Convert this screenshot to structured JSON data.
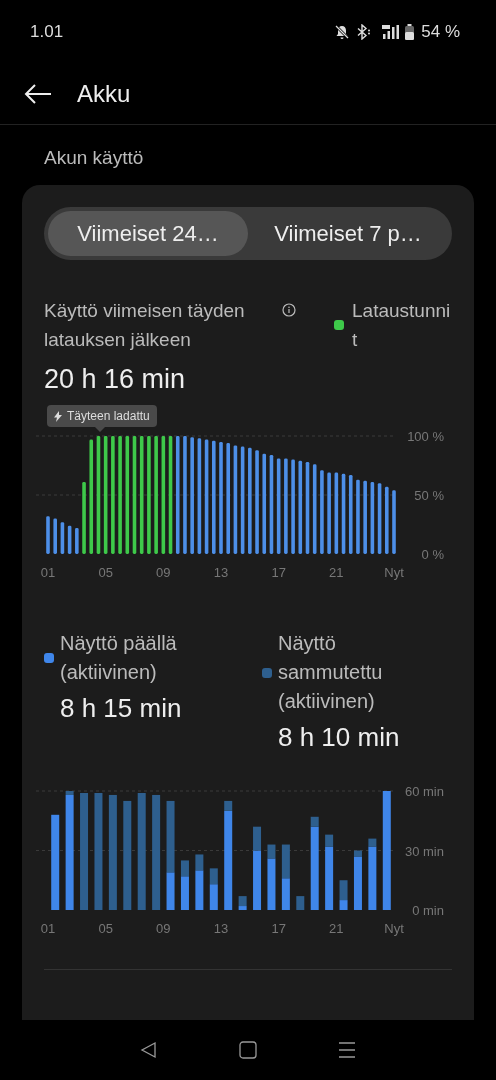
{
  "status_bar": {
    "time": "1.01",
    "battery": "54 %"
  },
  "header": {
    "title": "Akku"
  },
  "section_title": "Akun käyttö",
  "tabs": [
    {
      "label": "Viimeiset 24…",
      "selected": true
    },
    {
      "label": "Viimeiset 7 p…",
      "selected": false
    }
  ],
  "usage": {
    "label": "Käyttö viimeisen täyden latauksen jälkeen",
    "value": "20 h 16 min",
    "legend": {
      "label": "Lataustunnit",
      "color": "#3ec94a"
    }
  },
  "battery_chart": {
    "tooltip": "Täyteen ladattu",
    "chart_data": {
      "type": "bar",
      "stacked": true,
      "x": [
        1,
        1.5,
        2,
        2.5,
        3,
        3.5,
        4,
        4.5,
        5,
        5.5,
        6,
        6.5,
        7,
        7.5,
        8,
        8.5,
        9,
        9.5,
        10,
        10.5,
        11,
        11.5,
        12,
        12.5,
        13,
        13.5,
        14,
        14.5,
        15,
        15.5,
        16,
        16.5,
        17,
        17.5,
        18,
        18.5,
        19,
        19.5,
        20,
        20.5,
        21,
        21.5,
        22,
        22.5,
        23,
        23.5,
        24,
        24.5,
        25
      ],
      "series": [
        {
          "color": "#3ec94a",
          "values": [
            null,
            null,
            null,
            null,
            null,
            61,
            97,
            100,
            100,
            100,
            100,
            100,
            100,
            100,
            100,
            100,
            100,
            100,
            null,
            null,
            null,
            null,
            null,
            null,
            null,
            null,
            null,
            null,
            null,
            null,
            null,
            null,
            null,
            null,
            null,
            null,
            null,
            null,
            null,
            null,
            null,
            null,
            null,
            null,
            null,
            null,
            null,
            null,
            null
          ]
        },
        {
          "color": "#4d8fe8",
          "values": [
            32,
            30,
            27,
            24,
            22,
            null,
            null,
            null,
            null,
            null,
            null,
            null,
            null,
            null,
            null,
            null,
            null,
            null,
            100,
            100,
            99,
            98,
            97,
            96,
            95,
            94,
            92,
            91,
            90,
            88,
            85,
            84,
            81,
            81,
            80,
            79,
            78,
            76,
            71,
            69,
            69,
            68,
            67,
            63,
            62,
            61,
            60,
            57,
            54
          ]
        }
      ],
      "xlim": [
        1,
        25
      ],
      "ylim": [
        0,
        100
      ],
      "yticks": [
        {
          "value": 0,
          "label": "0 %"
        },
        {
          "value": 50,
          "label": "50 %"
        },
        {
          "value": 100,
          "label": "100 %"
        }
      ],
      "xticks": [
        {
          "value": 1,
          "label": "01"
        },
        {
          "value": 5,
          "label": "05"
        },
        {
          "value": 9,
          "label": "09"
        },
        {
          "value": 13,
          "label": "13"
        },
        {
          "value": 17,
          "label": "17"
        },
        {
          "value": 21,
          "label": "21"
        },
        {
          "value": 25,
          "label": "Nyt"
        }
      ]
    }
  },
  "screen": {
    "items": [
      {
        "label": "Näyttö päällä (aktiivinen)",
        "value": "8 h 15 min",
        "color": "#3f86ea"
      },
      {
        "label": "Näyttö sammutettu (aktiivinen)",
        "value": "8 h 10 min",
        "color": "#2e5f8e"
      }
    ]
  },
  "screen_chart": {
    "chart_data": {
      "type": "bar",
      "stacked": true,
      "x": [
        1.5,
        2.5,
        3.5,
        4.5,
        5.5,
        6.5,
        7.5,
        8.5,
        9.5,
        10.5,
        11.5,
        12.5,
        13.5,
        14.5,
        15.5,
        16.5,
        17.5,
        18.5,
        19.5,
        20.5,
        21.5,
        22.5,
        23.5,
        24.5
      ],
      "series": [
        {
          "color": "#3f86ea",
          "values": [
            48,
            58,
            0,
            0,
            0,
            0,
            0,
            0,
            19,
            17,
            20,
            13,
            50,
            2,
            30,
            26,
            16,
            0,
            42,
            32,
            5,
            27,
            32,
            60
          ]
        },
        {
          "color": "#2e5f8e",
          "values": [
            0,
            2,
            59,
            59,
            58,
            55,
            59,
            58,
            36,
            8,
            8,
            8,
            5,
            5,
            12,
            7,
            17,
            7,
            5,
            6,
            10,
            3,
            4,
            0
          ]
        }
      ],
      "xlim": [
        1,
        25
      ],
      "ylim": [
        0,
        60
      ],
      "yticks": [
        {
          "value": 0,
          "label": "0 min"
        },
        {
          "value": 30,
          "label": "30 min"
        },
        {
          "value": 60,
          "label": "60 min"
        }
      ],
      "xticks": [
        {
          "value": 1,
          "label": "01"
        },
        {
          "value": 5,
          "label": "05"
        },
        {
          "value": 9,
          "label": "09"
        },
        {
          "value": 13,
          "label": "13"
        },
        {
          "value": 17,
          "label": "17"
        },
        {
          "value": 21,
          "label": "21"
        },
        {
          "value": 25,
          "label": "Nyt"
        }
      ]
    }
  }
}
